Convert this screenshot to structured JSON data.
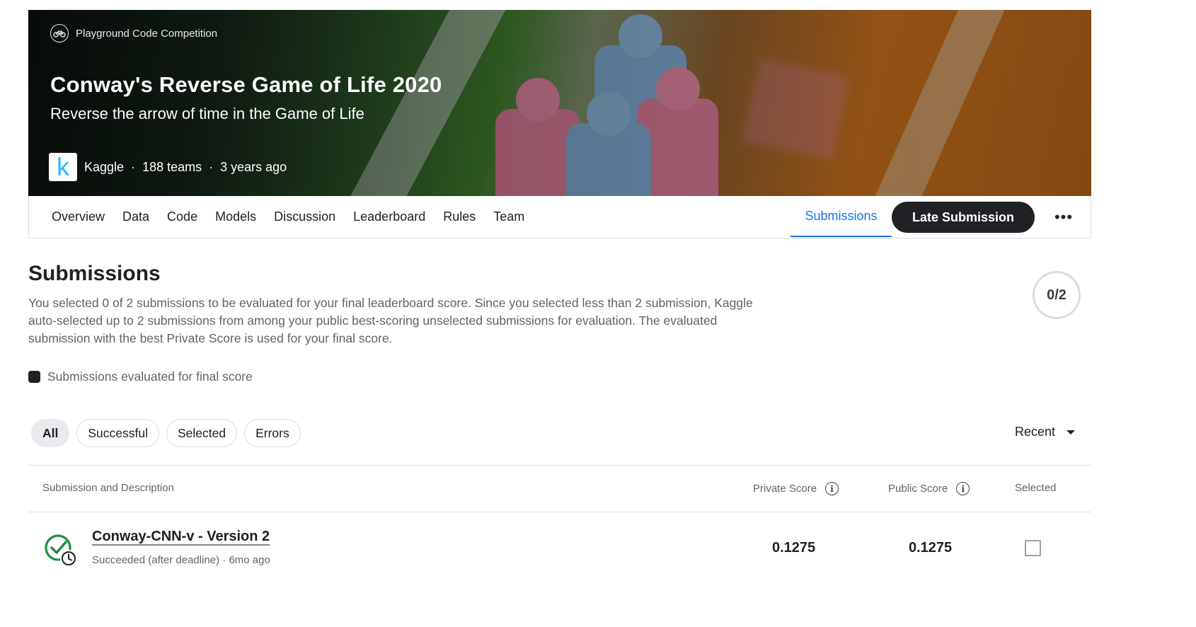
{
  "hero": {
    "competition_type": "Playground Code Competition",
    "title": "Conway's Reverse Game of Life 2020",
    "subtitle": "Reverse the arrow of time in the Game of Life",
    "host": "Kaggle",
    "logo_letter": "k",
    "teams": "188 teams",
    "age": "3 years ago",
    "separator": "·"
  },
  "nav": {
    "tabs": [
      "Overview",
      "Data",
      "Code",
      "Models",
      "Discussion",
      "Leaderboard",
      "Rules",
      "Team"
    ],
    "active_tab": "Submissions",
    "late_submission_label": "Late Submission",
    "more_label": "•••"
  },
  "submissions": {
    "title": "Submissions",
    "description": "You selected 0 of 2 submissions to be evaluated for your final leaderboard score. Since you selected less than 2 submission, Kaggle auto-selected up to 2 submissions from among your public best-scoring unselected submissions for evaluation. The evaluated submission with the best Private Score is used for your final score.",
    "selected_counter": "0/2",
    "legend_label": "Submissions evaluated for final score"
  },
  "filters": {
    "chips": [
      "All",
      "Successful",
      "Selected",
      "Errors"
    ],
    "active_chip": "All",
    "sort_label": "Recent"
  },
  "table": {
    "headers": {
      "submission": "Submission and Description",
      "private_score": "Private Score",
      "public_score": "Public Score",
      "selected": "Selected"
    },
    "info_glyph": "i",
    "rows": [
      {
        "title": "Conway-CNN-v - Version 2",
        "status": "Succeeded (after deadline) · 6mo ago",
        "private_score": "0.1275",
        "public_score": "0.1275",
        "selected": false
      }
    ]
  },
  "colors": {
    "accent_blue": "#1a73e8",
    "dark_button": "#202124",
    "success_green": "#1e8e3e"
  },
  "icons": {
    "competition_badge": "bicycle-icon",
    "status": "check-circle-clock-icon",
    "info": "info-icon",
    "sort": "caret-down-icon"
  }
}
